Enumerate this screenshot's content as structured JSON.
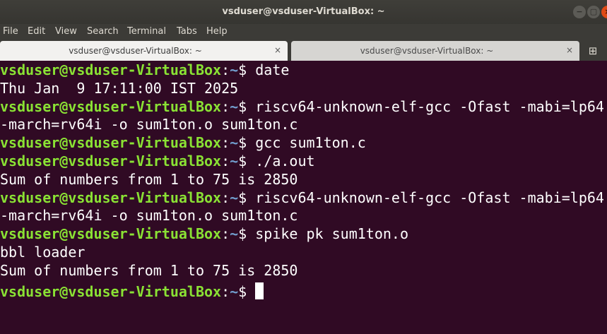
{
  "window": {
    "title": "vsduser@vsduser-VirtualBox: ~",
    "minimize_icon": "minimize-icon",
    "maximize_icon": "maximize-icon",
    "close_icon": "close-icon",
    "controls": {
      "minimize": "−",
      "maximize": "▢",
      "close": "×"
    }
  },
  "menu": {
    "items": [
      "File",
      "Edit",
      "View",
      "Search",
      "Terminal",
      "Tabs",
      "Help"
    ]
  },
  "tabs": [
    {
      "label": "vsduser@vsduser-VirtualBox: ~",
      "close": "×",
      "active": true
    },
    {
      "label": "vsduser@vsduser-VirtualBox: ~",
      "close": "×",
      "active": false
    }
  ],
  "new_tab_icon": "⊞",
  "prompt": {
    "user_host": "vsduser@vsduser-VirtualBox",
    "colon": ":",
    "path": "~",
    "symbol": "$"
  },
  "lines": [
    {
      "type": "prompt",
      "command": " date"
    },
    {
      "type": "output",
      "text": "Thu Jan  9 17:11:00 IST 2025"
    },
    {
      "type": "prompt",
      "command": " riscv64-unknown-elf-gcc -Ofast -mabi=lp64"
    },
    {
      "type": "output",
      "text": "-march=rv64i -o sum1ton.o sum1ton.c"
    },
    {
      "type": "prompt",
      "command": " gcc sum1ton.c"
    },
    {
      "type": "prompt",
      "command": " ./a.out"
    },
    {
      "type": "output",
      "text": "Sum of numbers from 1 to 75 is 2850"
    },
    {
      "type": "prompt",
      "command": " riscv64-unknown-elf-gcc -Ofast -mabi=lp64"
    },
    {
      "type": "output",
      "text": "-march=rv64i -o sum1ton.o sum1ton.c"
    },
    {
      "type": "prompt",
      "command": " spike pk sum1ton.o"
    },
    {
      "type": "output",
      "text": "bbl loader"
    },
    {
      "type": "output",
      "text": "Sum of numbers from 1 to 75 is 2850"
    },
    {
      "type": "prompt",
      "command": " "
    }
  ],
  "colors": {
    "background": "#300a24",
    "user_host": "#8ae234",
    "path": "#729fcf",
    "text": "#ffffff"
  }
}
